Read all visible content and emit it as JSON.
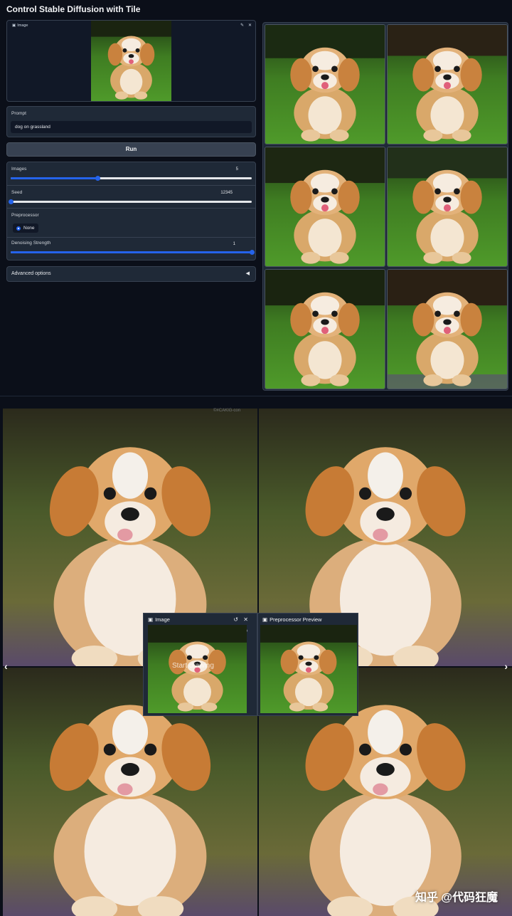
{
  "app": {
    "title": "Control Stable Diffusion with Tile"
  },
  "image_input": {
    "label": "Image",
    "edit_icon": "pencil-icon",
    "close_icon": "close-icon"
  },
  "prompt": {
    "label": "Prompt",
    "value": "dog on grassland"
  },
  "run": {
    "label": "Run"
  },
  "controls": {
    "images": {
      "label": "Images",
      "value": "5",
      "fraction": 0.36
    },
    "seed": {
      "label": "Seed",
      "value": "12345",
      "fraction": 0.0
    },
    "preprocessor": {
      "label": "Preprocessor",
      "option": "None"
    },
    "denoising": {
      "label": "Denoising Strength",
      "value": "1",
      "fraction": 1.0
    }
  },
  "advanced": {
    "label": "Advanced options",
    "icon": "triangle-left-icon"
  },
  "gallery": {
    "count": 6
  },
  "collage": {
    "image_label": "Image",
    "preview_label": "Preprocessor Preview",
    "overlay_text": "Start drawing",
    "left_arrow": "‹",
    "right_arrow": "›",
    "watermark": "知乎 @代码狂魔",
    "faint_text": "©#CAKIG-con"
  },
  "colors": {
    "accent": "#2563eb",
    "panel": "#1f2937",
    "bg": "#0b0f19"
  }
}
